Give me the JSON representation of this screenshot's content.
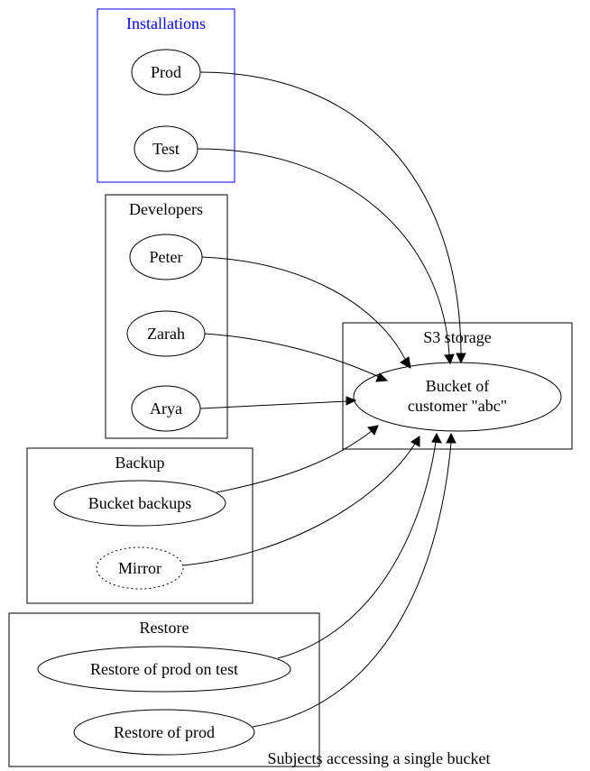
{
  "caption": "Subjects accessing a single bucket",
  "clusters": {
    "installations": {
      "title": "Installations"
    },
    "developers": {
      "title": "Developers"
    },
    "backup": {
      "title": "Backup"
    },
    "restore": {
      "title": "Restore"
    },
    "storage": {
      "title": "S3 storage"
    }
  },
  "nodes": {
    "prod": {
      "label": "Prod"
    },
    "test": {
      "label": "Test"
    },
    "peter": {
      "label": "Peter"
    },
    "zarah": {
      "label": "Zarah"
    },
    "arya": {
      "label": "Arya"
    },
    "bucketbackups": {
      "label": "Bucket backups"
    },
    "mirror": {
      "label": "Mirror"
    },
    "restore_test": {
      "label": "Restore of prod on test"
    },
    "restore_prod": {
      "label": "Restore of prod"
    },
    "bucket_line1": "Bucket of",
    "bucket_line2": "customer \"abc\""
  }
}
